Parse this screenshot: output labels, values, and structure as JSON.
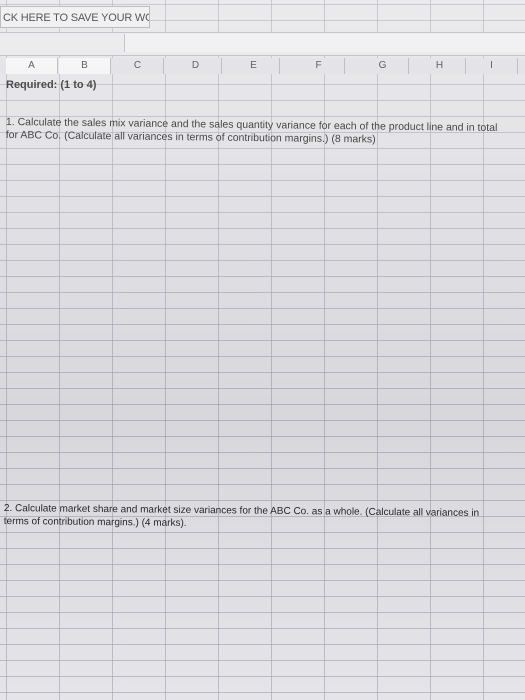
{
  "toolbar": {
    "save_label": "CK HERE TO SAVE YOUR WORK"
  },
  "columns": [
    "A",
    "B",
    "C",
    "D",
    "E",
    "F",
    "G",
    "H",
    "I"
  ],
  "sheet": {
    "required_label": "Required: (1 to 4)",
    "q1": "1. Calculate the sales mix variance and the sales quantity variance for each of the product line and in total for ABC Co. (Calculate all variances in terms of contribution margins.)   (8 marks)",
    "q2": "2. Calculate market share and market size variances for the ABC Co. as a whole. (Calculate all variances in terms of contribution margins.)   (4 marks)."
  }
}
